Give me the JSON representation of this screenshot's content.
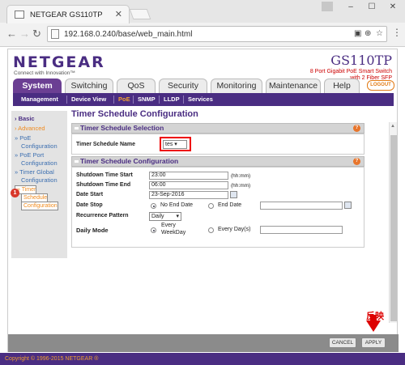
{
  "browser": {
    "tab_title": "NETGEAR GS110TP",
    "url": "192.168.0.240/base/web_main.html",
    "window_buttons": [
      "–",
      "☐",
      "✕"
    ]
  },
  "header": {
    "logo": "NETGEAR",
    "tagline": "Connect with Innovation™",
    "model": "GS110TP",
    "model_desc_1": "8 Port Gigabit PoE Smart Switch",
    "model_desc_2": "with 2 Fiber SFP",
    "logout": "LOGOUT"
  },
  "main_tabs": [
    "System",
    "Switching",
    "QoS",
    "Security",
    "Monitoring",
    "Maintenance",
    "Help"
  ],
  "sub_nav": [
    "Management",
    "Device View",
    "PoE",
    "SNMP",
    "LLDP",
    "Services"
  ],
  "left_nav": {
    "basic": "Basic",
    "advanced": "Advanced",
    "items": [
      "» PoE",
      "Configuration",
      "» PoE Port",
      "Configuration",
      "» Timer Global",
      "Configuration",
      "» Timer",
      "Schedule",
      "Configuration"
    ],
    "marker": "1"
  },
  "page_title": "Timer Schedule Configuration",
  "selection": {
    "header": "Timer Schedule Selection",
    "name_label": "Timer Schedule Name",
    "name_value": "tes"
  },
  "config": {
    "header": "Timer Schedule Configuration",
    "shutdown_start_label": "Shutdown Time Start",
    "shutdown_start_value": "23:00",
    "shutdown_end_label": "Shutdown Time End",
    "shutdown_end_value": "06:00",
    "unit": "(hh:mm)",
    "date_start_label": "Date Start",
    "date_start_value": "23-Sep-2016",
    "date_stop_label": "Date Stop",
    "no_end_date": "No End Date",
    "end_date": "End Date",
    "recurrence_label": "Recurrence Pattern",
    "recurrence_value": "Daily",
    "daily_mode_label": "Daily Mode",
    "every_weekday_1": "Every",
    "every_weekday_2": "WeekDay",
    "every_days": "Every Day(s)"
  },
  "buttons": {
    "cancel": "CANCEL",
    "apply": "APPLY"
  },
  "callout": "反映",
  "footer": "Copyright © 1996-2015 NETGEAR ®"
}
